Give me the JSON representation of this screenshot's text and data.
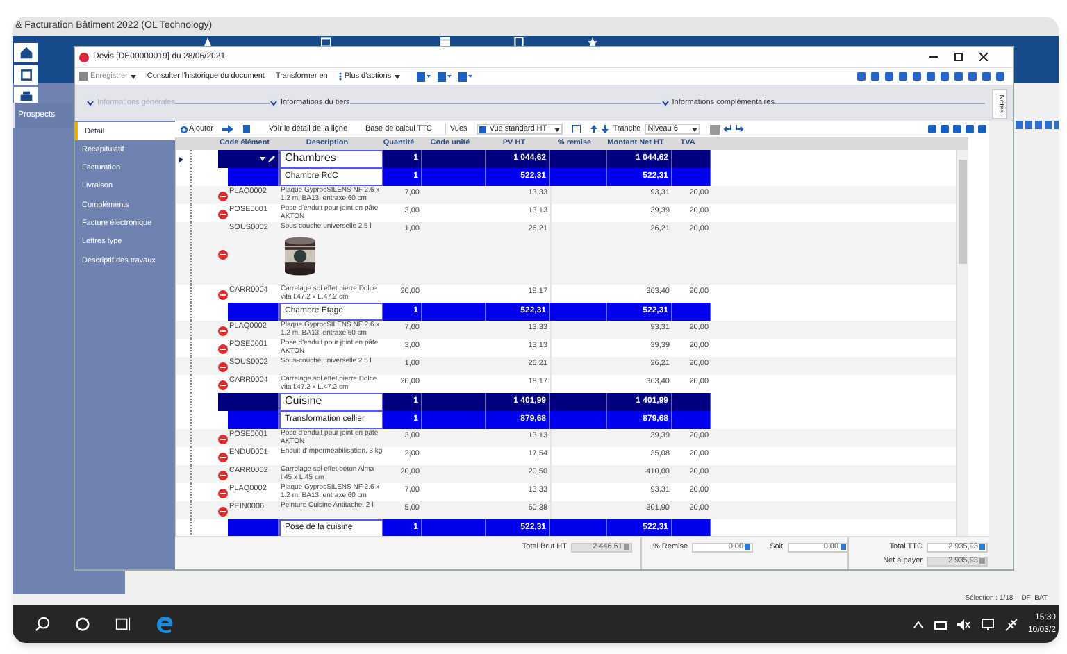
{
  "app": {
    "title": "& Facturation Bâtiment 2022 (OL Technology)",
    "side_label": "Prospects"
  },
  "dialog": {
    "title": "Devis [DE00000019] du 28/06/2021",
    "toolbar": [
      {
        "label": "Enregistrer",
        "kind": "save",
        "disabled": true
      },
      {
        "label": "Consulter l'historique du document",
        "kind": "button",
        "disabled": false
      },
      {
        "label": "Transformer en",
        "kind": "button",
        "disabled": false
      },
      {
        "label": "Plus d'actions",
        "kind": "more",
        "disabled": false
      }
    ],
    "sections": [
      {
        "label": "Informations générales",
        "dimmed": true
      },
      {
        "label": "Informations du tiers",
        "dimmed": false
      },
      {
        "label": "Informations complémentaires",
        "dimmed": false
      }
    ],
    "notes_tab": "Notes"
  },
  "nav": [
    {
      "label": "Détail",
      "selected": true
    },
    {
      "label": "Récapitulatif",
      "selected": false
    },
    {
      "label": "Facturation",
      "selected": false
    },
    {
      "label": "Livraison",
      "selected": false
    },
    {
      "label": "Compléments",
      "selected": false
    },
    {
      "label": "Facture électronique",
      "selected": false
    },
    {
      "label": "Lettres type",
      "selected": false
    },
    {
      "label": "Descriptif des travaux",
      "selected": false
    }
  ],
  "grid_toolbar": {
    "add": "Ajouter",
    "detail": "Voir le détail de la ligne",
    "ttc": "Base de calcul TTC",
    "views_label": "Vues",
    "view": "Vue standard HT",
    "slice_label": "Tranche",
    "level": "Niveau 6"
  },
  "columns": [
    "Code élément",
    "Description",
    "Quantité",
    "Code unité",
    "PV HT",
    "% remise",
    "Montant Net HT",
    "TVA"
  ],
  "rows": [
    {
      "kind": "group",
      "current": true,
      "description": "Chambres",
      "quantity": "1",
      "pv_ht": "1 044,62",
      "net_ht": "1 044,62",
      "children": [
        {
          "kind": "group",
          "current": false,
          "description": "Chambre RdC",
          "quantity": "1",
          "pv_ht": "522,31",
          "net_ht": "522,31",
          "children": [
            {
              "kind": "item",
              "code": "PLAQ0002",
              "description": "Plaque GyprocSILENS NF 2.6 x 1.2 m, BA13, entraxe 60 cm",
              "quantity": "7,00",
              "pv_ht": "13,33",
              "net_ht": "93,31",
              "vat": "20,00"
            },
            {
              "kind": "item",
              "code": "POSE0001",
              "description": "Pose d'enduit pour joint en pâte AKTON",
              "quantity": "3,00",
              "pv_ht": "13,13",
              "net_ht": "39,39",
              "vat": "20,00"
            },
            {
              "kind": "item",
              "code": "SOUS0002",
              "description": "Sous-couche universelle 2.5 l",
              "quantity": "1,00",
              "pv_ht": "26,21",
              "net_ht": "26,21",
              "vat": "20,00"
            },
            {
              "kind": "item",
              "code": "CARR0004",
              "description": "Carrelage sol effet pierre Dolce vita l.47.2 x L.47.2 cm",
              "quantity": "20,00",
              "pv_ht": "18,17",
              "net_ht": "363,40",
              "vat": "20,00"
            }
          ]
        },
        {
          "kind": "group",
          "current": false,
          "description": "Chambre Etage",
          "quantity": "1",
          "pv_ht": "522,31",
          "net_ht": "522,31",
          "children": [
            {
              "kind": "item",
              "code": "PLAQ0002",
              "description": "Plaque GyprocSILENS NF 2.6 x 1.2 m, BA13, entraxe 60 cm",
              "quantity": "7,00",
              "pv_ht": "13,33",
              "net_ht": "93,31",
              "vat": "20,00"
            },
            {
              "kind": "item",
              "code": "POSE0001",
              "description": "Pose d'enduit pour joint en pâte AKTON",
              "quantity": "3,00",
              "pv_ht": "13,13",
              "net_ht": "39,39",
              "vat": "20,00"
            },
            {
              "kind": "item",
              "code": "SOUS0002",
              "description": "Sous-couche universelle 2.5 l",
              "quantity": "1,00",
              "pv_ht": "26,21",
              "net_ht": "26,21",
              "vat": "20,00"
            },
            {
              "kind": "item",
              "code": "CARR0004",
              "description": "Carrelage sol effet pierre Dolce vita l.47.2 x L.47.2 cm",
              "quantity": "20,00",
              "pv_ht": "18,17",
              "net_ht": "363,40",
              "vat": "20,00"
            }
          ]
        }
      ]
    },
    {
      "kind": "group",
      "current": false,
      "description": "Cuisine",
      "quantity": "1",
      "pv_ht": "1 401,99",
      "net_ht": "1 401,99",
      "children": [
        {
          "kind": "group",
          "current": false,
          "description": "Transformation cellier",
          "quantity": "1",
          "pv_ht": "879,68",
          "net_ht": "879,68",
          "children": [
            {
              "kind": "item",
              "code": "POSE0001",
              "description": "Pose d'enduit pour joint en pâte AKTON",
              "quantity": "3,00",
              "pv_ht": "13,13",
              "net_ht": "39,39",
              "vat": "20,00"
            },
            {
              "kind": "item",
              "code": "ENDU0001",
              "description": "Enduit d'imperméabilisation, 3 kg",
              "quantity": "2,00",
              "pv_ht": "17,54",
              "net_ht": "35,08",
              "vat": "20,00"
            },
            {
              "kind": "item",
              "code": "CARR0002",
              "description": "Carrelage sol effet béton Alma l.45 x L.45 cm",
              "quantity": "20,00",
              "pv_ht": "20,50",
              "net_ht": "410,00",
              "vat": "20,00"
            },
            {
              "kind": "item",
              "code": "PLAQ0002",
              "description": "Plaque GyprocSILENS NF 2.6 x 1.2 m, BA13, entraxe 60 cm",
              "quantity": "7,00",
              "pv_ht": "13,33",
              "net_ht": "93,31",
              "vat": "20,00"
            },
            {
              "kind": "item",
              "code": "PEIN0006",
              "description": "Peinture Cuisine Antitache. 2 l",
              "quantity": "5,00",
              "pv_ht": "60,38",
              "net_ht": "301,90",
              "vat": "20,00"
            }
          ]
        },
        {
          "kind": "group",
          "current": false,
          "description": "Pose de la cuisine",
          "quantity": "1",
          "pv_ht": "522,31",
          "net_ht": "522,31"
        }
      ]
    }
  ],
  "totals": {
    "gross": {
      "label": "Total Brut HT",
      "value": "2 446,61"
    },
    "discount": {
      "label": "% Remise",
      "value": "0,00"
    },
    "amount": {
      "label": "Soit",
      "value": "0,00"
    },
    "ttc": {
      "label": "Total TTC",
      "value": "2 935,93"
    },
    "net": {
      "label": "Net à payer",
      "value": "2 935,93"
    }
  },
  "status_bar": {
    "selection": "Sélection : 1/18",
    "database": "DF_BAT"
  },
  "taskbar": {
    "time": "15:30",
    "date": "10/03/2"
  }
}
